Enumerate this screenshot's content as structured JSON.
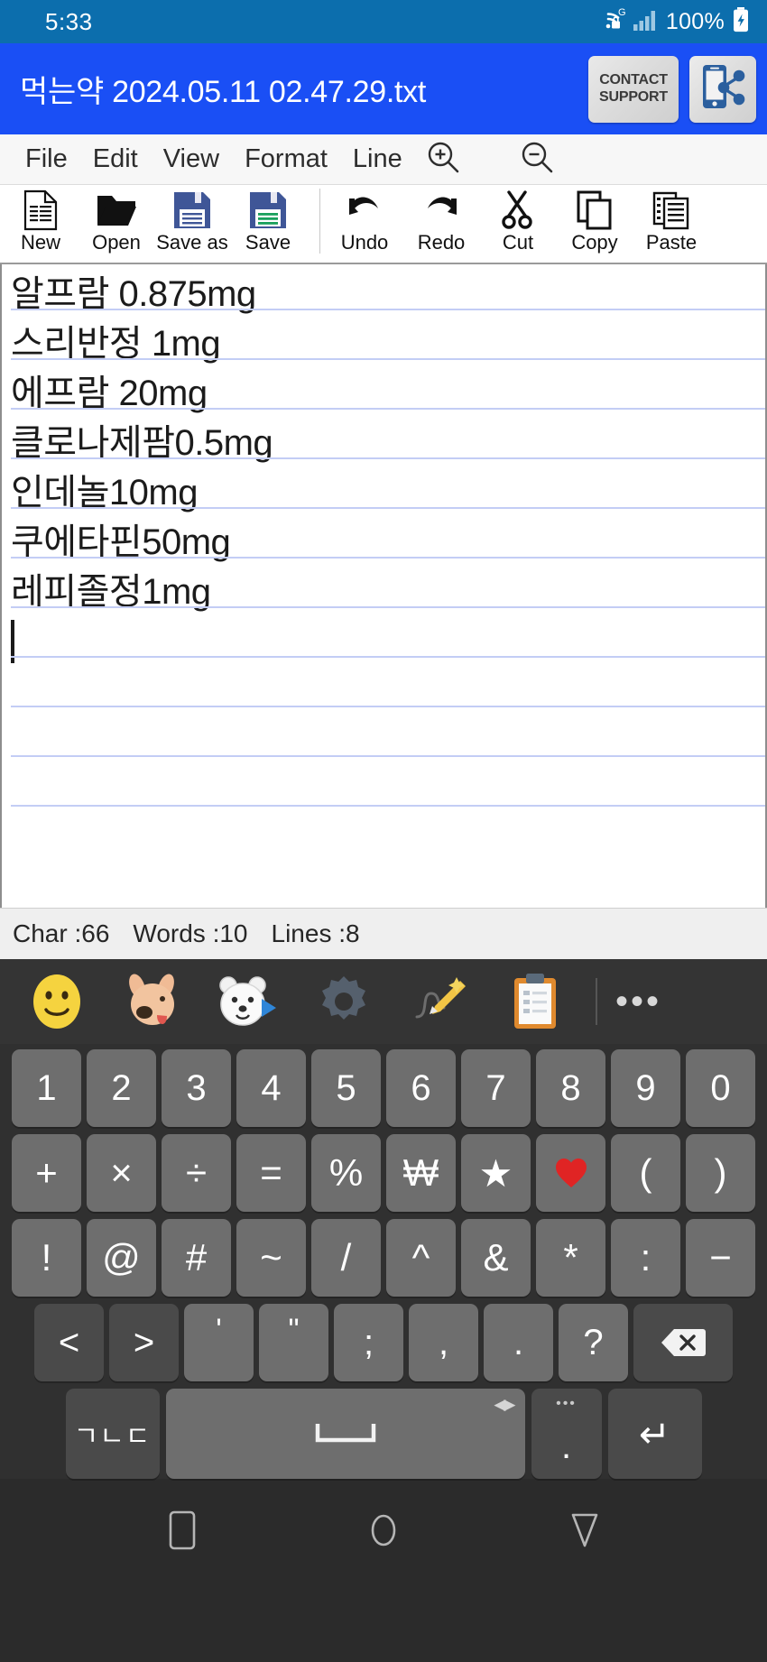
{
  "status_bar": {
    "clock": "5:33",
    "battery_percent": "100%",
    "icons": [
      "wifi-lock-icon",
      "signal-bars-icon",
      "battery-charging-icon"
    ],
    "background": "#0c6ead"
  },
  "title_bar": {
    "file_name": "먹는약 2024.05.11 02.47.29.txt",
    "support_button": {
      "line1": "CONTACT",
      "line2": "SUPPORT"
    },
    "share_button_label": "share-app-icon",
    "background": "#1a4ff5"
  },
  "menu_bar": {
    "items": [
      {
        "label": "File"
      },
      {
        "label": "Edit"
      },
      {
        "label": "View"
      },
      {
        "label": "Format"
      },
      {
        "label": "Line"
      }
    ],
    "zoom_in_label": "zoom-in-icon",
    "zoom_out_label": "zoom-out-icon"
  },
  "toolbar": {
    "group1": [
      {
        "label": "New",
        "icon": "new-document-icon"
      },
      {
        "label": "Open",
        "icon": "open-folder-icon"
      },
      {
        "label": "Save as",
        "icon": "save-as-floppy-icon"
      },
      {
        "label": "Save",
        "icon": "save-floppy-icon"
      }
    ],
    "group2": [
      {
        "label": "Undo",
        "icon": "undo-arrow-icon"
      },
      {
        "label": "Redo",
        "icon": "redo-arrow-icon"
      },
      {
        "label": "Cut",
        "icon": "scissors-icon"
      },
      {
        "label": "Copy",
        "icon": "copy-icon"
      },
      {
        "label": "Paste",
        "icon": "paste-icon"
      }
    ]
  },
  "editor": {
    "lines": [
      "알프람 0.875mg",
      "스리반정 1mg",
      "에프람 20mg",
      "클로나제팜0.5mg",
      "인데놀10mg",
      "쿠에타핀50mg",
      "레피졸정1mg"
    ],
    "cursor_line_index": 7,
    "rule_color": "#c3cdf5"
  },
  "count_bar": {
    "char": "Char :66",
    "words": "Words :10",
    "lines": "Lines :8"
  },
  "keyboard": {
    "toolbar_icons": [
      {
        "name": "emoji-smiley-icon",
        "glyph": "🙂"
      },
      {
        "name": "emoji-dog-sticker-icon",
        "glyph": "🐶"
      },
      {
        "name": "emoji-bear-gif-icon",
        "glyph": "🐻‍❄"
      },
      {
        "name": "settings-gear-icon",
        "glyph": "⚙"
      },
      {
        "name": "handwriting-pen-icon",
        "glyph": "✏"
      },
      {
        "name": "clipboard-icon",
        "glyph": "📋"
      }
    ],
    "more_label": "•••",
    "row1": [
      "1",
      "2",
      "3",
      "4",
      "5",
      "6",
      "7",
      "8",
      "9",
      "0"
    ],
    "row2": [
      "+",
      "×",
      "÷",
      "=",
      "%",
      "₩",
      "★",
      "❤",
      "(",
      ")"
    ],
    "row3": [
      "!",
      "@",
      "#",
      "~",
      "/",
      "^",
      "&",
      "*",
      ":",
      "−"
    ],
    "row4": [
      "<",
      ">",
      "'",
      "\"",
      ";",
      ",",
      ".",
      "?"
    ],
    "backspace_label": "backspace-icon",
    "row5": {
      "language_key": "ㄱㄴㄷ",
      "space_key": "space-bar-icon",
      "dot_key": ".",
      "dot_key_dots": "•••",
      "enter_key": "↵"
    }
  },
  "nav_bar": {
    "recents_label": "recents-square-icon",
    "home_label": "home-circle-icon",
    "back_label": "back-triangle-icon"
  }
}
